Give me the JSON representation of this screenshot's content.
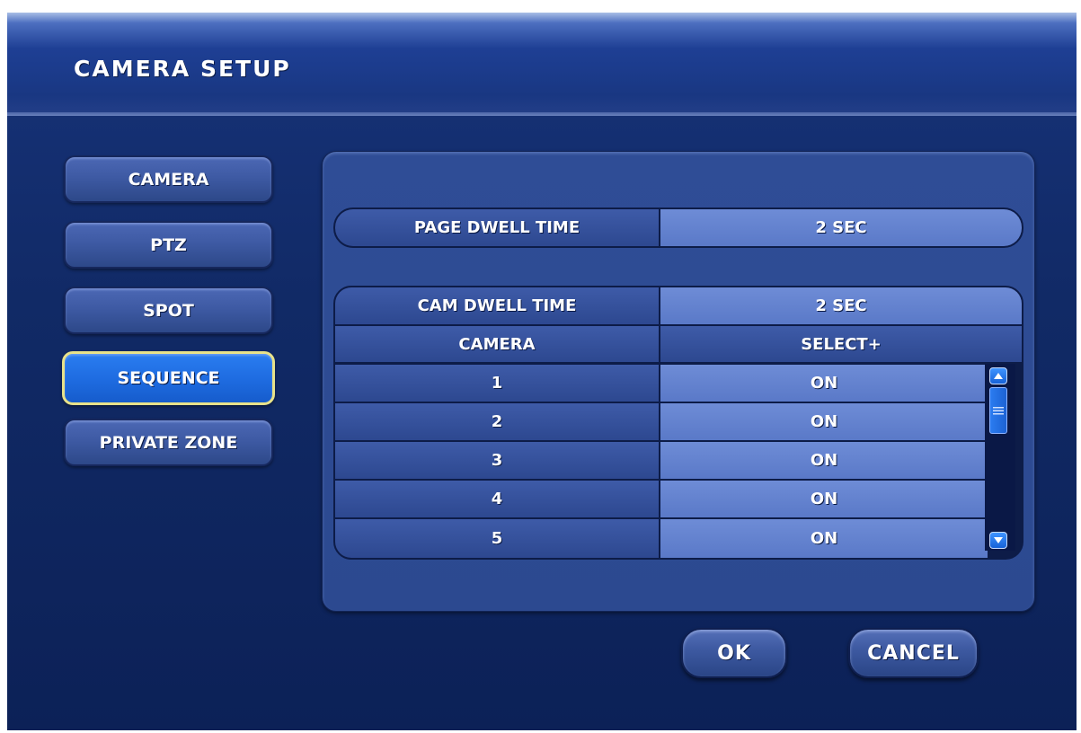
{
  "window": {
    "title": "CAMERA SETUP"
  },
  "nav": {
    "items": [
      {
        "label": "CAMERA"
      },
      {
        "label": "PTZ"
      },
      {
        "label": "SPOT"
      },
      {
        "label": "SEQUENCE",
        "active": true
      },
      {
        "label": "PRIVATE ZONE"
      }
    ]
  },
  "settings": {
    "page_dwell": {
      "label": "PAGE DWELL TIME",
      "value": "2 SEC"
    },
    "cam_dwell": {
      "label": "CAM DWELL TIME",
      "value": "2 SEC"
    },
    "table": {
      "header_camera": "CAMERA",
      "header_select": "SELECT+",
      "rows": [
        {
          "camera": "1",
          "state": "ON"
        },
        {
          "camera": "2",
          "state": "ON"
        },
        {
          "camera": "3",
          "state": "ON"
        },
        {
          "camera": "4",
          "state": "ON"
        },
        {
          "camera": "5",
          "state": "ON"
        }
      ]
    }
  },
  "actions": {
    "ok": "OK",
    "cancel": "CANCEL"
  },
  "colors": {
    "accent_active": "#1e6be0",
    "active_border": "#e8e28a",
    "background": "#112a66"
  }
}
